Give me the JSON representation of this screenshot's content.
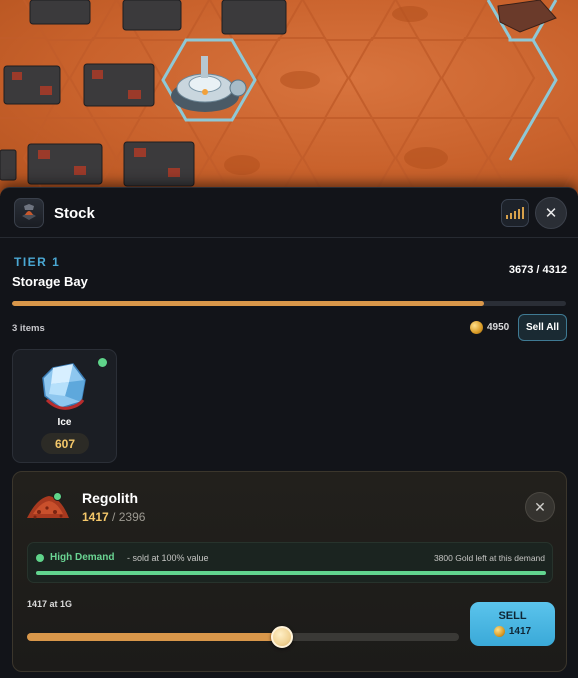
{
  "panel": {
    "title": "Stock",
    "icon": "stock-crate-icon"
  },
  "storage": {
    "tier": "TIER 1",
    "name": "Storage Bay",
    "capacity": "3673 / 4312",
    "fill_fraction": 0.852
  },
  "inventory": {
    "count_label": "3 items",
    "gold": "4950",
    "sell_all_label": "Sell All",
    "items": [
      {
        "name": "Ice",
        "quantity": "607",
        "icon": "ice-crystal-icon",
        "status_color": "#5fd48a"
      }
    ]
  },
  "selected": {
    "name": "Regolith",
    "quantity": "1417",
    "max": "/ 2396",
    "icon": "regolith-pile-icon",
    "demand_label": "High Demand",
    "demand_sub": "- sold at 100% value",
    "demand_left": "3800 Gold left at this demand",
    "demand_fraction": 1.0,
    "price_label": "1417 at 1G",
    "slider_fraction": 0.59,
    "sell_label": "SELL",
    "sell_amount": "1417"
  },
  "colors": {
    "accent_blue": "#4aa8d4",
    "gold": "#f5c86a",
    "demand_green": "#62d58f",
    "bar_orange": "#d9974a"
  }
}
